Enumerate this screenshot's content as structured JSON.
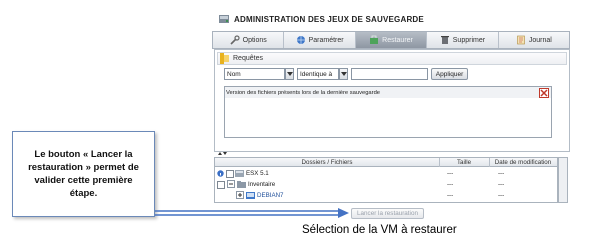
{
  "window": {
    "title": "ADMINISTRATION DES JEUX DE SAUVEGARDE"
  },
  "toolbar": {
    "tabs": [
      {
        "label": "Options",
        "icon": "tools-icon"
      },
      {
        "label": "Paramétrer",
        "icon": "globe-icon"
      },
      {
        "label": "Restaurer",
        "icon": "restore-icon",
        "active": true
      },
      {
        "label": "Supprimer",
        "icon": "trash-icon"
      },
      {
        "label": "Journal",
        "icon": "journal-icon"
      }
    ]
  },
  "requests": {
    "section_label": "Requêtes",
    "field_select": "Nom",
    "operator_select": "Identique à",
    "value_input": "",
    "apply_label": "Appliquer",
    "filter_row": "Version des fichiers présents lors de la dernière sauvegarde"
  },
  "tree": {
    "columns": [
      "Dossiers / Fichiers",
      "Taille",
      "Date de modification"
    ],
    "rows": [
      {
        "name": "ESX 5.1",
        "size": "---",
        "date": "---"
      },
      {
        "name": "Inventaire",
        "size": "---",
        "date": "---"
      },
      {
        "name": "DEBIAN7",
        "size": "---",
        "date": "---"
      }
    ]
  },
  "actions": {
    "launch_label": "Lancer la restauration"
  },
  "callout": {
    "text": "Le bouton « Lancer la restauration » permet de valider cette première étape."
  },
  "caption": "Sélection de la VM à restaurer",
  "colors": {
    "accent_blue": "#4472c4",
    "toolbar_active": "#8e97a3",
    "callout_border": "#6b89b8"
  }
}
